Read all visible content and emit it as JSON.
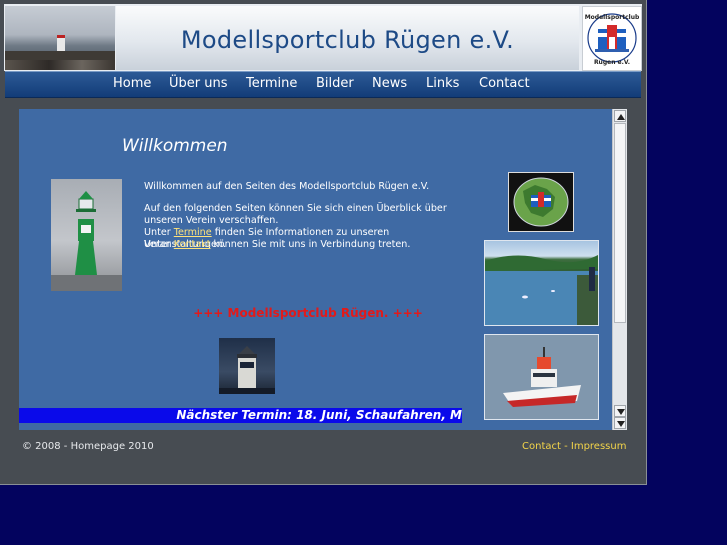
{
  "header": {
    "title": "Modellsportclub Rügen e.V.",
    "logo_text_top": "Modellsportclub",
    "logo_text_bottom": "Rügen e.V."
  },
  "nav": {
    "items": [
      "Home",
      "Über uns",
      "Termine",
      "Bilder",
      "News",
      "Links",
      "Contact"
    ]
  },
  "content": {
    "welcome_title": "Willkommen",
    "intro": "Willkommen auf den Seiten des Modellsportclub Rügen e.V.",
    "overview": "Auf den folgenden Seiten können Sie sich einen Überblick über unseren Verein verschaffen.",
    "termine_prefix": "Unter ",
    "termine_link": "Termine",
    "termine_suffix": " finden Sie Informationen zu unseren Veranstaltungen.",
    "kontakt_prefix": "Unter ",
    "kontakt_link": "Kontakt",
    "kontakt_suffix": " können Sie mit uns in Verbindung treten.",
    "marquee": "+++ Modellsportclub Rügen. +++",
    "ticker": "Nächster Termin: 18. Juni, Schaufahren, M"
  },
  "footer": {
    "copyright": "© 2008 - Homepage 2010",
    "contact": "Contact",
    "separator": " - ",
    "impressum": "Impressum"
  },
  "colors": {
    "page_bg": "#03035e",
    "content_bg": "#3f6aa4",
    "title_blue": "#1d4a86",
    "marquee_red": "#e21a1a",
    "ticker_bg": "#0a0aea",
    "footer_link": "#f3d44a"
  }
}
